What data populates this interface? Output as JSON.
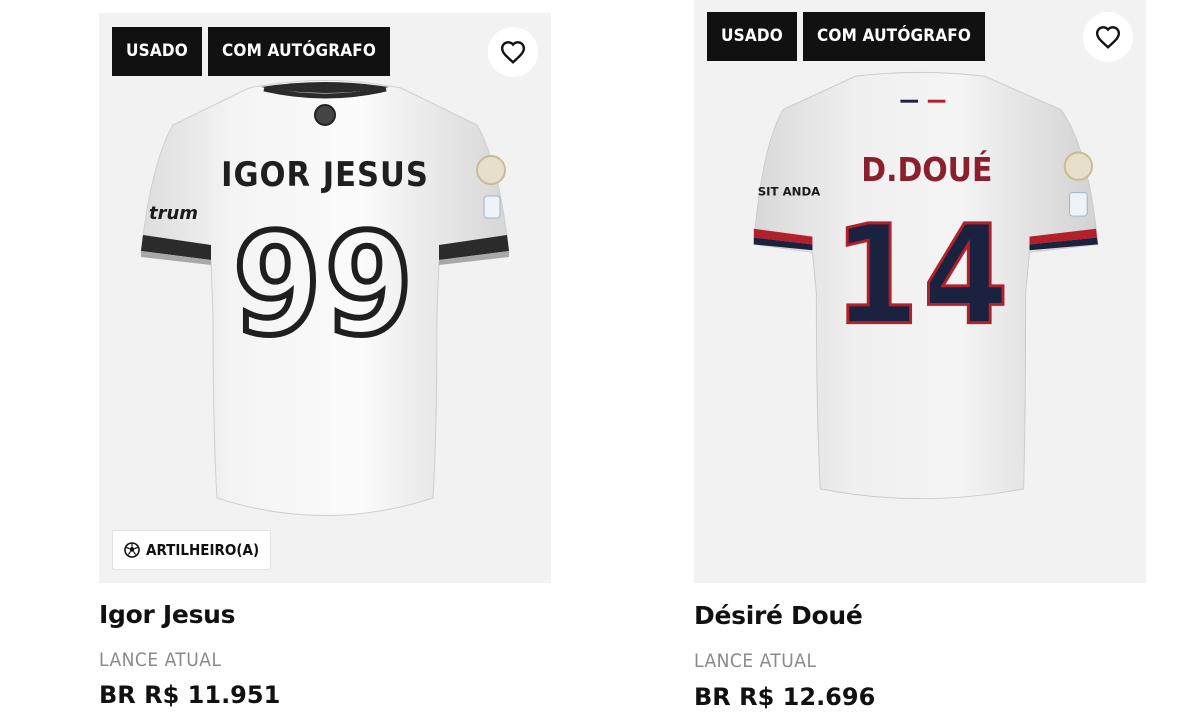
{
  "products": [
    {
      "tags": [
        "USADO",
        "COM AUTÓGRAFO"
      ],
      "shirt": {
        "name": "IGOR JESUS",
        "number": "99",
        "sleeve_sponsor": "trum",
        "trim_color": "#2b2b2b",
        "number_color": "#1f1f1f"
      },
      "badge": {
        "icon": "soccer-ball-icon",
        "label": "ARTILHEIRO(A)"
      },
      "title": "Igor Jesus",
      "bid_label": "LANCE ATUAL",
      "price": "BR R$ 11.951"
    },
    {
      "tags": [
        "USADO",
        "COM AUTÓGRAFO"
      ],
      "shirt": {
        "name": "D.DOUÉ",
        "number": "14",
        "sleeve_sponsor": "SIT ANDA",
        "trim_color": "#b3202a",
        "number_color": "#1b2240"
      },
      "title": "Désiré Doué",
      "bid_label": "LANCE ATUAL",
      "price": "BR R$ 12.696"
    }
  ],
  "icons": {
    "favorite": "heart-outline-icon"
  }
}
